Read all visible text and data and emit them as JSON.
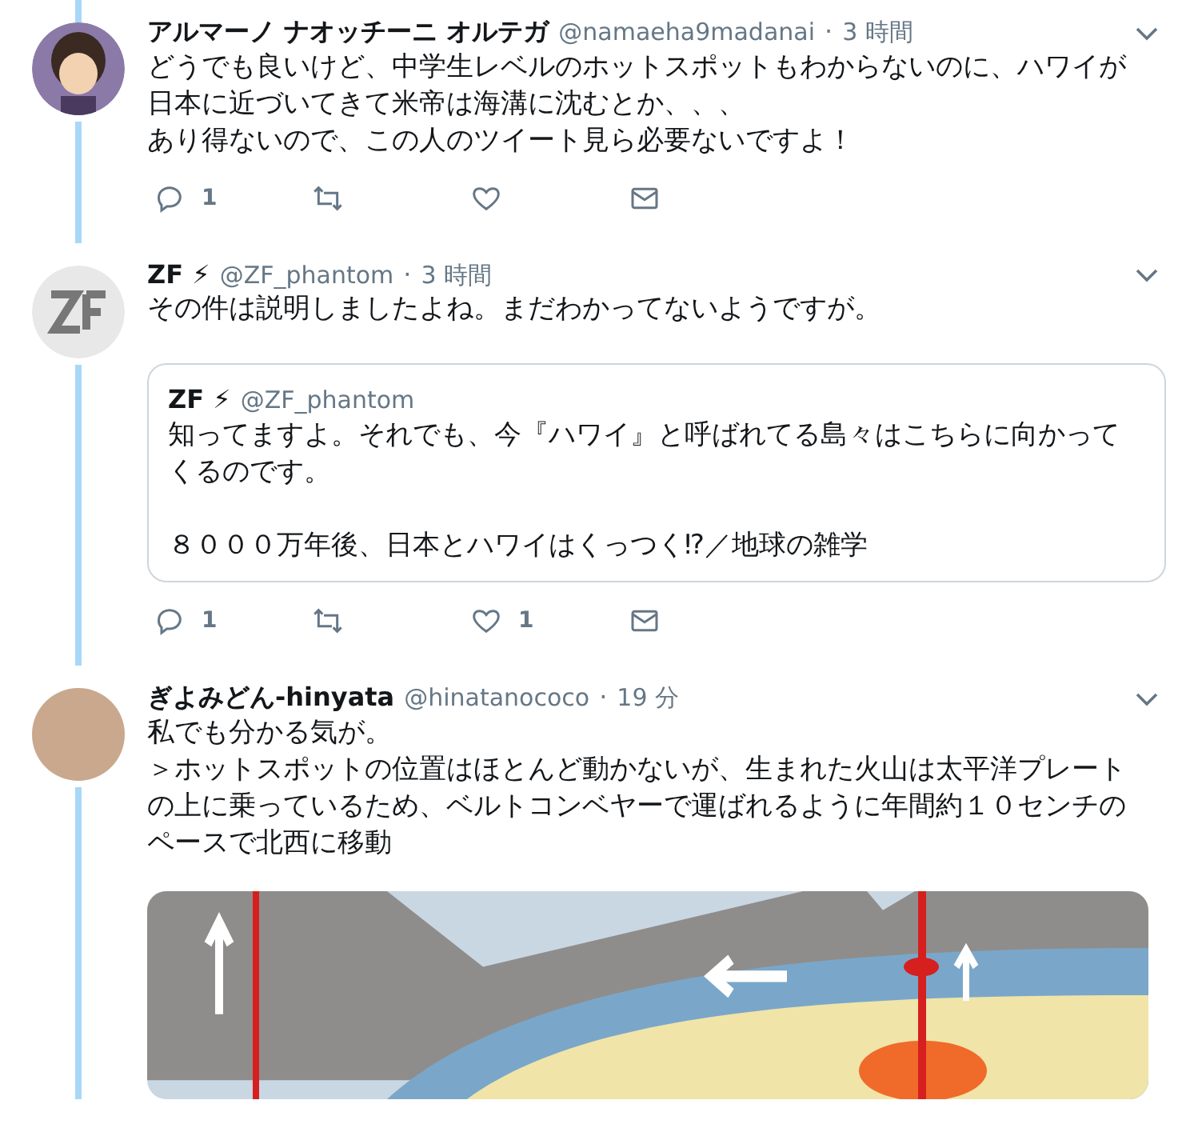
{
  "tweets": [
    {
      "name": "アルマーノ ナオッチーニ オルテガ",
      "handle": "@namaeha9madanai",
      "separator": "·",
      "time": "3 時間",
      "lines": [
        "どうでも良いけど、中学生レベルのホットスポットもわからないのに、ハワイが日本に近づいてきて米帝は海溝に沈むとか、、、",
        "あり得ないので、この人のツイート見ら必要ないですよ！"
      ],
      "actions": {
        "replies": "1"
      }
    },
    {
      "name": "ZF ⚡",
      "handle": "@ZF_phantom",
      "separator": "·",
      "time": "3 時間",
      "lines": [
        "その件は説明しましたよね。まだわかってないようですが。"
      ],
      "quote": {
        "name": "ZF ⚡",
        "handle": "@ZF_phantom",
        "lines": [
          "知ってますよ。それでも、今『ハワイ』と呼ばれてる島々はこちらに向かってくるのです。",
          "８０００万年後、日本とハワイはくっつく⁉／地球の雑学"
        ]
      },
      "actions": {
        "replies": "1",
        "likes": "1"
      }
    },
    {
      "name": "ぎよみどん-hinyata",
      "handle": "@hinatanococo",
      "separator": "·",
      "time": "19 分",
      "lines": [
        "私でも分かる気が。",
        "＞ホットスポットの位置はほとんど動かないが、生まれた火山は太平洋プレートの上に乗っているため、ベルトコンベヤーで運ばれるように年間約１０センチのペースで北西に移動"
      ],
      "media": {
        "kind": "diagram"
      }
    }
  ]
}
